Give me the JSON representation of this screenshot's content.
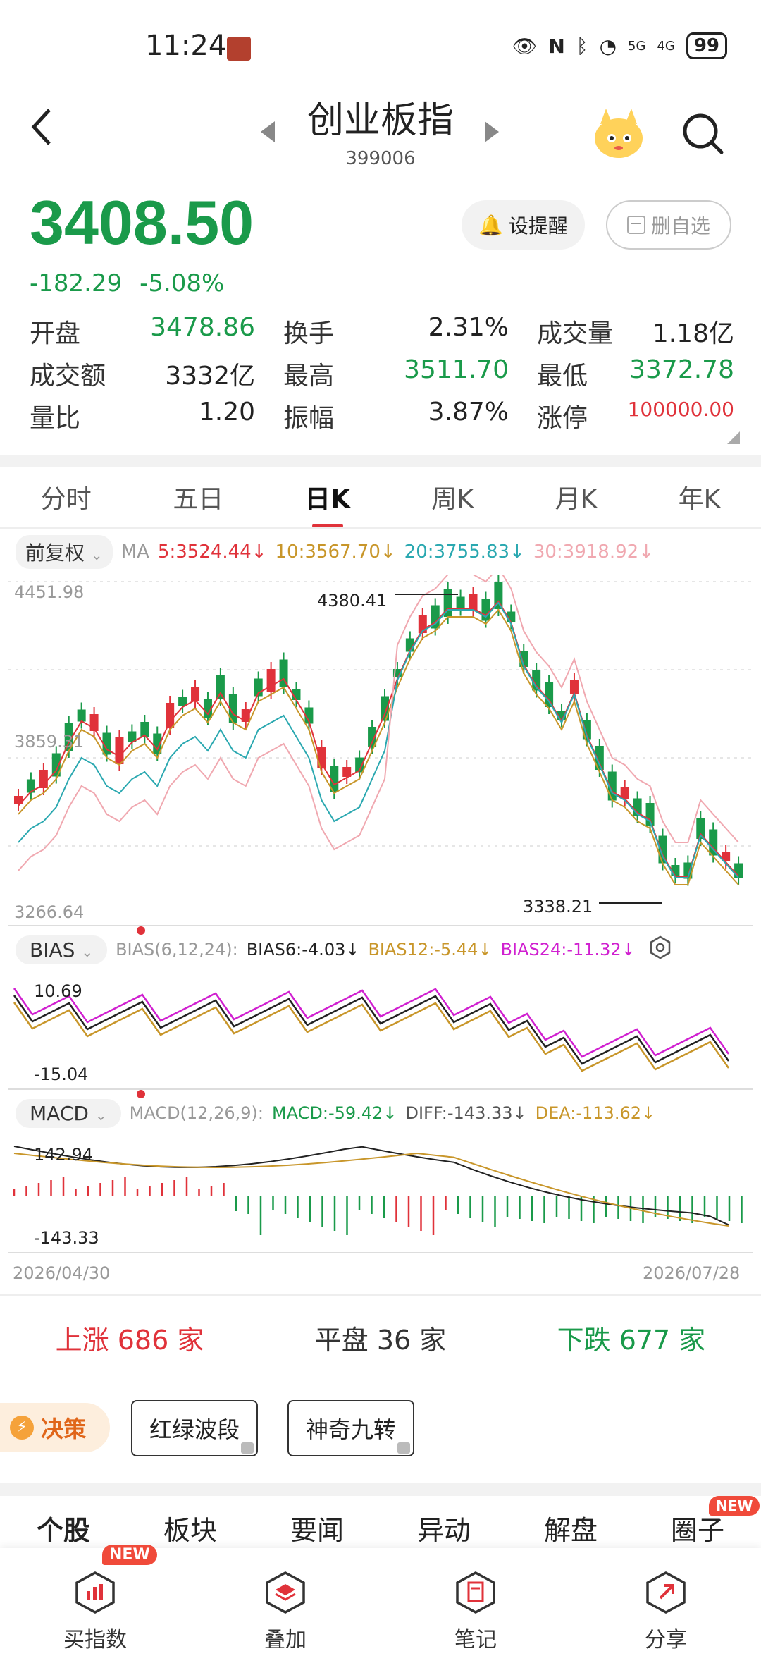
{
  "status": {
    "time": "11:24",
    "battery": "99",
    "net1": "5G",
    "net2": "4G"
  },
  "header": {
    "title": "创业板指",
    "code": "399006"
  },
  "quote": {
    "price": "3408.50",
    "change": "-182.29",
    "change_pct": "-5.08%",
    "alert_label": "设提醒",
    "remove_label": "删自选"
  },
  "stats": [
    [
      {
        "label": "开盘",
        "value": "3478.86",
        "color": "green"
      },
      {
        "label": "换手",
        "value": "2.31%",
        "color": "black"
      },
      {
        "label": "成交量",
        "value": "1.18亿",
        "color": "black"
      }
    ],
    [
      {
        "label": "成交额",
        "value": "3332亿",
        "color": "black"
      },
      {
        "label": "最高",
        "value": "3511.70",
        "color": "green"
      },
      {
        "label": "最低",
        "value": "3372.78",
        "color": "green"
      }
    ],
    [
      {
        "label": "量比",
        "value": "1.20",
        "color": "black"
      },
      {
        "label": "振幅",
        "value": "3.87%",
        "color": "black"
      },
      {
        "label": "涨停",
        "value": "100000.00",
        "color": "red"
      }
    ]
  ],
  "tabs": [
    "分时",
    "五日",
    "日K",
    "周K",
    "月K",
    "年K"
  ],
  "active_tab": "日K",
  "ma": {
    "adjust_label": "前复权",
    "prefix": "MA",
    "ma5": "5:3524.44↓",
    "ma10": "10:3567.70↓",
    "ma20": "20:3755.83↓",
    "ma30": "30:3918.92↓"
  },
  "kline_axis": {
    "top": "4451.98",
    "mid": "3859.31",
    "bottom": "3266.64",
    "high_mark": "4380.41",
    "low_mark": "3338.21"
  },
  "bias": {
    "label": "BIAS",
    "params": "BIAS(6,12,24):",
    "b6": "BIAS6:-4.03↓",
    "b12": "BIAS12:-5.44↓",
    "b24": "BIAS24:-11.32↓",
    "top": "10.69",
    "bottom": "-15.04"
  },
  "macd": {
    "label": "MACD",
    "params": "MACD(12,26,9):",
    "macd": "MACD:-59.42↓",
    "diff": "DIFF:-143.33↓",
    "dea": "DEA:-113.62↓",
    "top": "142.94",
    "bottom": "-143.33"
  },
  "date_range": {
    "start": "2026/04/30",
    "end": "2026/07/28"
  },
  "breadth": {
    "up": "上涨 686 家",
    "flat": "平盘 36 家",
    "down": "下跌 677 家"
  },
  "tools": {
    "decision": "决策",
    "btn1": "红绿波段",
    "btn2": "神奇九转"
  },
  "bottom_tabs": [
    "个股",
    "板块",
    "要闻",
    "异动",
    "解盘",
    "圈子"
  ],
  "bottom_new": "NEW",
  "nav": [
    {
      "label": "买指数",
      "badge": "NEW"
    },
    {
      "label": "叠加",
      "badge": ""
    },
    {
      "label": "笔记",
      "badge": ""
    },
    {
      "label": "分享",
      "badge": ""
    }
  ],
  "colors": {
    "up": "#e0323a",
    "down": "#1a9a4a",
    "ma5": "#e0323a",
    "ma10": "#c8962a",
    "ma20": "#2aa8b0",
    "ma30": "#f0a8b0"
  }
}
